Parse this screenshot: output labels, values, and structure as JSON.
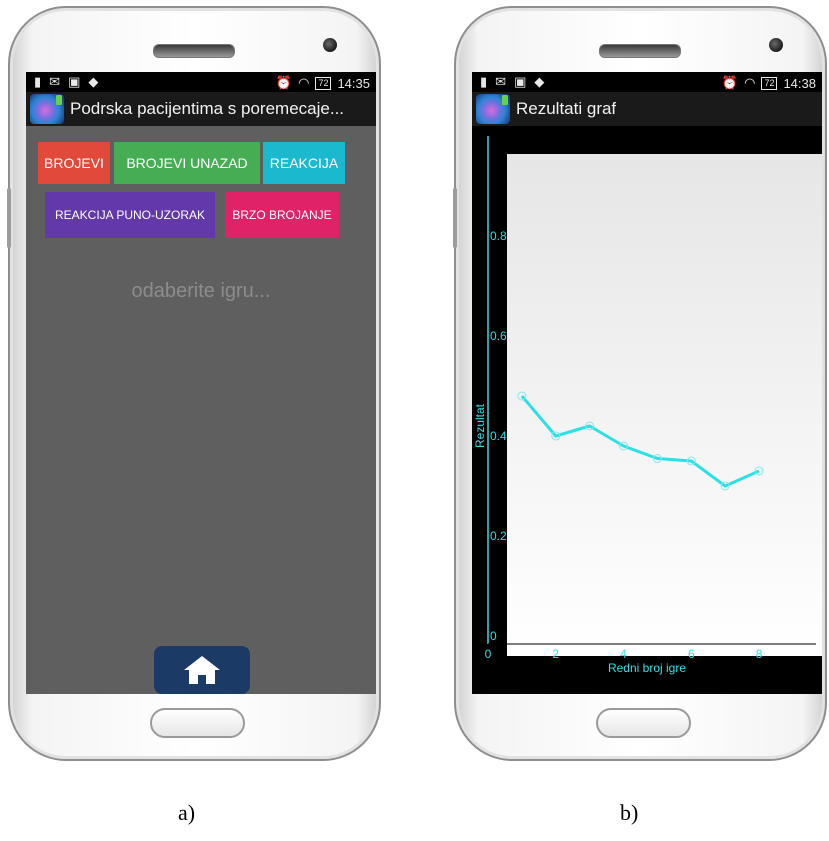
{
  "phone_a": {
    "status": {
      "time": "14:35",
      "battery": "72"
    },
    "app_title": "Podrska pacijentima s poremecaje...",
    "buttons": [
      {
        "label": "BROJEVI",
        "color": "#e14a3a"
      },
      {
        "label": "BROJEVI UNAZAD",
        "color": "#46ad54"
      },
      {
        "label": "REAKCIJA",
        "color": "#1bb9cd"
      },
      {
        "label": "REAKCIJA PUNO-UZORAK",
        "color": "#6338a9"
      },
      {
        "label": "BRZO BROJANJE",
        "color": "#e02369"
      }
    ],
    "hint": "odaberite igru...",
    "home_icon": "home-icon"
  },
  "phone_b": {
    "status": {
      "time": "14:38",
      "battery": "72"
    },
    "app_title": "Rezultati graf",
    "zoom_icons": [
      "zoom-in-icon",
      "zoom-out-icon",
      "zoom-reset-icon"
    ]
  },
  "chart_data": {
    "type": "line",
    "xlabel": "Redni broj igre",
    "ylabel": "Rezultat",
    "xlim": [
      0,
      8.5
    ],
    "ylim": [
      0,
      1
    ],
    "x_ticks": [
      "0",
      "2",
      "4",
      "6",
      "8"
    ],
    "y_ticks": [
      "0",
      "0.2",
      "0.4",
      "0.6",
      "0.8"
    ],
    "line_color": "#2de0e6",
    "series": [
      {
        "x": [
          1,
          2,
          3,
          4,
          5,
          6,
          7,
          8
        ],
        "values": [
          0.48,
          0.4,
          0.42,
          0.38,
          0.355,
          0.35,
          0.3,
          0.33
        ]
      }
    ]
  },
  "captions": {
    "a": "a)",
    "b": "b)"
  }
}
